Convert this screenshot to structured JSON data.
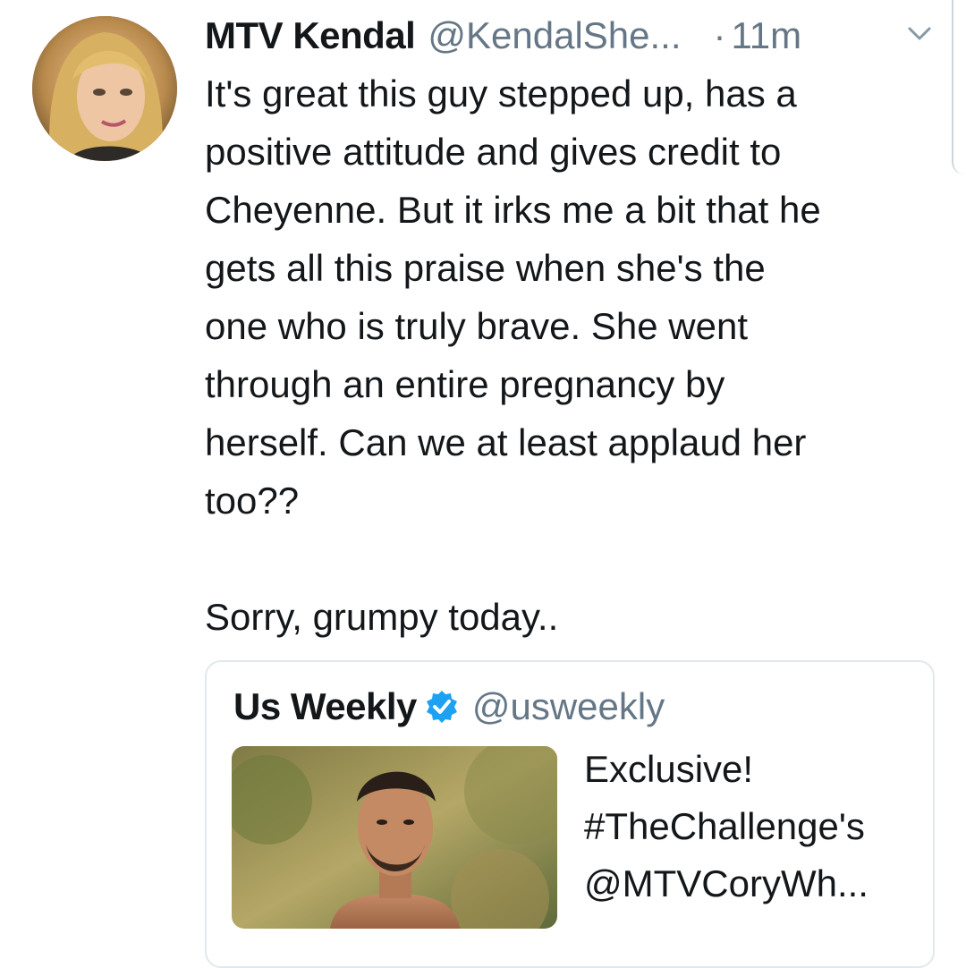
{
  "tweet": {
    "author_name": "MTV Kendal",
    "author_handle": "@KendalShe...",
    "separator": "·",
    "timestamp": "11m",
    "text_lines": [
      "It's great this guy stepped up, has a",
      "positive attitude and gives credit to",
      "Cheyenne. But it irks me a bit that he",
      "gets all this praise when she's the",
      "one who is truly brave. She went",
      "through an entire pregnancy by",
      "herself. Can we at least applaud her",
      "too??"
    ],
    "text_footer": "Sorry, grumpy today..",
    "menu_icon": "chevron-down-icon",
    "avatar_icon": "avatar"
  },
  "quote": {
    "author_name": "Us Weekly",
    "verified_icon": "verified-badge-icon",
    "author_handle": "@usweekly",
    "text_lines": [
      "Exclusive!",
      "#TheChallenge's",
      "@MTVCoryWh..."
    ]
  },
  "colors": {
    "primary_text": "#14171a",
    "secondary_text": "#657786",
    "verified_blue": "#1da1f2",
    "card_border": "#e1e8ed"
  }
}
